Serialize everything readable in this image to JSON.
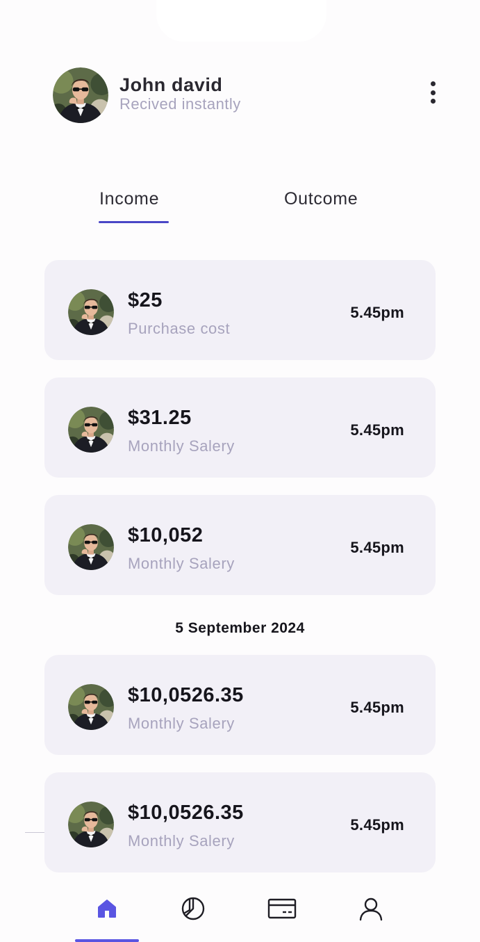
{
  "user": {
    "name": "John david",
    "subtitle": "Recived instantly"
  },
  "tabs": [
    {
      "label": "Income",
      "active": true
    },
    {
      "label": "Outcome",
      "active": false
    }
  ],
  "transactions": [
    {
      "amount": "$25",
      "description": "Purchase cost",
      "time": "5.45pm"
    },
    {
      "amount": "$31.25",
      "description": "Monthly Salery",
      "time": "5.45pm"
    },
    {
      "amount": "$10,052",
      "description": "Monthly Salery",
      "time": "5.45pm"
    }
  ],
  "date_group": {
    "label": "5 September 2024",
    "transactions": [
      {
        "amount": "$10,0526.35",
        "description": "Monthly Salery",
        "time": "5.45pm"
      },
      {
        "amount": "$10,0526.35",
        "description": "Monthly Salery",
        "time": "5.45pm"
      }
    ]
  },
  "bottom_nav": [
    {
      "icon": "home-icon",
      "active": true
    },
    {
      "icon": "pie-chart-icon",
      "active": false
    },
    {
      "icon": "credit-card-icon",
      "active": false
    },
    {
      "icon": "user-icon",
      "active": false
    }
  ],
  "colors": {
    "accent": "#4a46c6",
    "nav_active": "#5a55e2",
    "card_background": "#f2f0f7",
    "muted_text": "#a7a3bd",
    "primary_text": "#16151c"
  }
}
